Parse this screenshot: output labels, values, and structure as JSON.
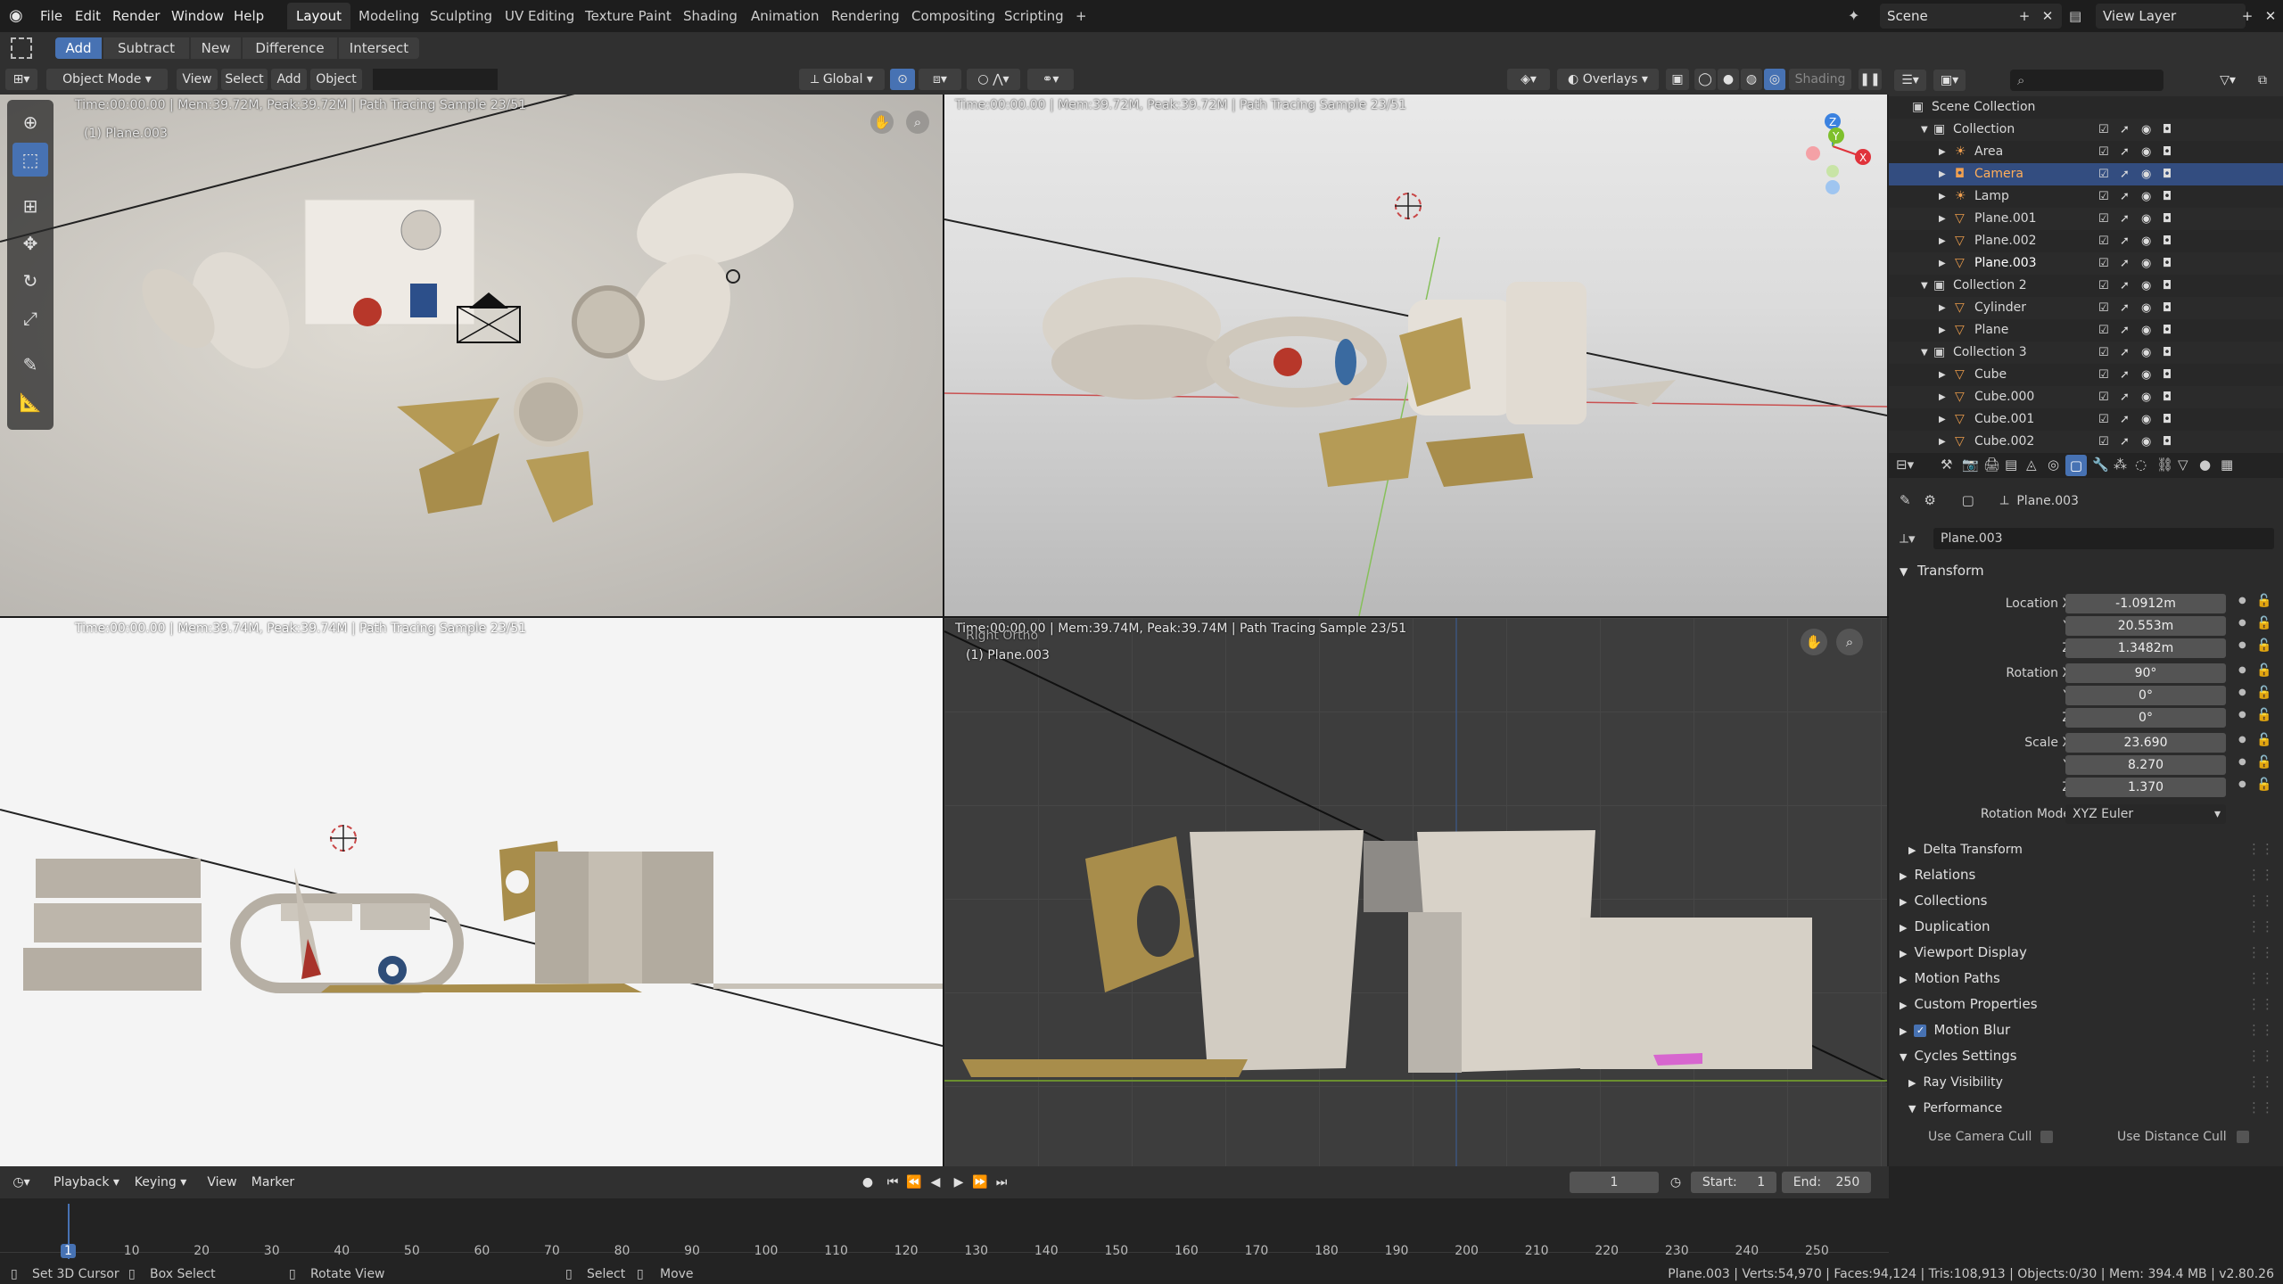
{
  "topbar": {
    "menus": [
      "File",
      "Edit",
      "Render",
      "Window",
      "Help"
    ],
    "workspaces": [
      "Layout",
      "Modeling",
      "Sculpting",
      "UV Editing",
      "Texture Paint",
      "Shading",
      "Animation",
      "Rendering",
      "Compositing",
      "Scripting"
    ],
    "active_workspace": "Layout",
    "add_tab": "+",
    "scene": "Scene",
    "view_layer": "View Layer"
  },
  "toolhdr": {
    "ops": [
      "Add",
      "Subtract",
      "New",
      "Difference",
      "Intersect"
    ]
  },
  "viewport_header": {
    "mode": "Object Mode",
    "menus": [
      "View",
      "Select",
      "Add",
      "Object"
    ],
    "transform": "Global",
    "overlays": "Overlays",
    "shading": "Shading"
  },
  "viewports": {
    "top_left": {
      "stats": "Time:00:00.00 | Mem:39.72M, Peak:39.72M | Path Tracing Sample 23/51",
      "label": "(1) Plane.003"
    },
    "top_right": {
      "stats": "Time:00:00.00 | Mem:39.72M, Peak:39.72M | Path Tracing Sample 23/51"
    },
    "bottom_left": {
      "stats": "Time:00:00.00 | Mem:39.74M, Peak:39.74M | Path Tracing Sample 23/51"
    },
    "bottom_right": {
      "stats": "Time:00:00.00 | Mem:39.74M, Peak:39.74M | Path Tracing Sample 23/51",
      "view_name": "Right Ortho",
      "label": "(1) Plane.003"
    }
  },
  "outliner": {
    "rows": [
      {
        "name": "Scene Collection",
        "indent": 0,
        "icon": "scene-collection-icon"
      },
      {
        "name": "Collection",
        "indent": 1,
        "icon": "collection-icon"
      },
      {
        "name": "Area",
        "indent": 2,
        "icon": "light-icon"
      },
      {
        "name": "Camera",
        "indent": 2,
        "icon": "camera-icon"
      },
      {
        "name": "Lamp",
        "indent": 2,
        "icon": "light-icon"
      },
      {
        "name": "Plane.001",
        "indent": 2,
        "icon": "mesh-icon"
      },
      {
        "name": "Plane.002",
        "indent": 2,
        "icon": "mesh-icon"
      },
      {
        "name": "Plane.003",
        "indent": 2,
        "icon": "mesh-icon"
      },
      {
        "name": "Collection 2",
        "indent": 1,
        "icon": "collection-icon"
      },
      {
        "name": "Cylinder",
        "indent": 2,
        "icon": "mesh-icon"
      },
      {
        "name": "Plane",
        "indent": 2,
        "icon": "mesh-icon"
      },
      {
        "name": "Collection 3",
        "indent": 1,
        "icon": "collection-icon"
      },
      {
        "name": "Cube",
        "indent": 2,
        "icon": "mesh-icon"
      },
      {
        "name": "Cube.000",
        "indent": 2,
        "icon": "mesh-icon"
      },
      {
        "name": "Cube.001",
        "indent": 2,
        "icon": "mesh-icon"
      },
      {
        "name": "Cube.002",
        "indent": 2,
        "icon": "mesh-icon"
      }
    ]
  },
  "properties": {
    "breadcrumb": "Plane.003",
    "object_name": "Plane.003",
    "transform_title": "Transform",
    "location": {
      "label_x": "Location X",
      "label_y": "Y",
      "label_z": "Z",
      "x": "-1.0912m",
      "y": "20.553m",
      "z": "1.3482m"
    },
    "rotation": {
      "label_x": "Rotation X",
      "label_y": "Y",
      "label_z": "Z",
      "x": "90°",
      "y": "0°",
      "z": "0°"
    },
    "scale": {
      "label_x": "Scale X",
      "label_y": "Y",
      "label_z": "Z",
      "x": "23.690",
      "y": "8.270",
      "z": "1.370"
    },
    "rotation_mode_label": "Rotation Mode",
    "rotation_mode": "XYZ Euler",
    "panels": [
      "Delta Transform",
      "Relations",
      "Collections",
      "Duplication",
      "Viewport Display",
      "Motion Paths",
      "Custom Properties",
      "Motion Blur",
      "Cycles Settings",
      "Ray Visibility",
      "Performance"
    ],
    "use_camera_cull": "Use Camera Cull",
    "use_distance_cull": "Use Distance Cull"
  },
  "timeline": {
    "menus": [
      "Playback",
      "Keying",
      "View",
      "Marker"
    ],
    "current_frame": "1",
    "start_label": "Start:",
    "start": "1",
    "end_label": "End:",
    "end": "250",
    "ticks": [
      "1",
      "10",
      "20",
      "30",
      "40",
      "50",
      "60",
      "70",
      "80",
      "90",
      "100",
      "110",
      "120",
      "130",
      "140",
      "150",
      "160",
      "170",
      "180",
      "190",
      "200",
      "210",
      "220",
      "230",
      "240",
      "250"
    ]
  },
  "statusbar": {
    "hints": [
      "Set 3D Cursor",
      "Box Select",
      "Rotate View",
      "Select",
      "Move"
    ],
    "info": "Plane.003 | Verts:54,970 | Faces:94,124 | Tris:108,913 | Objects:0/30 | Mem: 394.4 MB | v2.80.26"
  },
  "colors": {
    "accent": "#4772b3",
    "selected_row": "#334d80",
    "x_axis": "#e0333b",
    "y_axis": "#7ec02c",
    "z_axis": "#3b82e0"
  }
}
